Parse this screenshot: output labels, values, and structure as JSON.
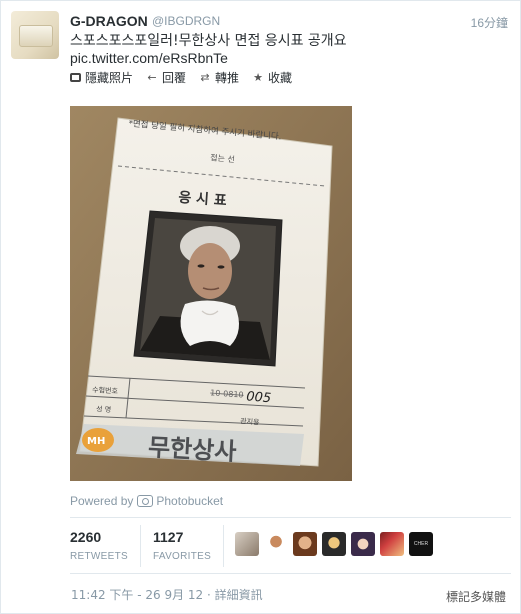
{
  "tweet": {
    "name": "G-DRAGON",
    "handle": "@IBGDRGN",
    "time": "16分鐘",
    "text": "스포스포스포일러!무한상사 면접 응시표 공개요",
    "link": "pic.twitter.com/eRsRbnTe"
  },
  "actions": [
    {
      "label": "隱藏照片",
      "icon": "photo-icon"
    },
    {
      "label": "回覆",
      "icon": "reply-icon"
    },
    {
      "label": "轉推",
      "icon": "retweet-icon"
    },
    {
      "label": "收藏",
      "icon": "star-icon"
    }
  ],
  "photo": {
    "top_notice": "*면접 당일 필히 지참하여 주시기 바랍니다.",
    "fold_line": "접는 선",
    "title": "응 시 표",
    "row1_label": "수험번호",
    "row2_label": "성 명",
    "handwritten_number": "005",
    "struck_number": "10-0810",
    "official_use": "관지용",
    "company_logo_text": "무한상사",
    "badge_text": "MH"
  },
  "powered_by": {
    "prefix": "Powered by",
    "brand": "Photobucket"
  },
  "stats": {
    "retweets_count": "2260",
    "retweets_label": "RETWEETS",
    "favorites_count": "1127",
    "favorites_label": "FAVORITES"
  },
  "faces_badge_text": "CHER HUE",
  "footer": {
    "timestamp": "11:42 下午 - 26 9月 12 · 詳細資訊",
    "media_flag": "標記多媒體"
  },
  "colors": {
    "meta_gray": "#8899a6",
    "text_dark": "#292f33",
    "divider": "#e1e8ed"
  }
}
